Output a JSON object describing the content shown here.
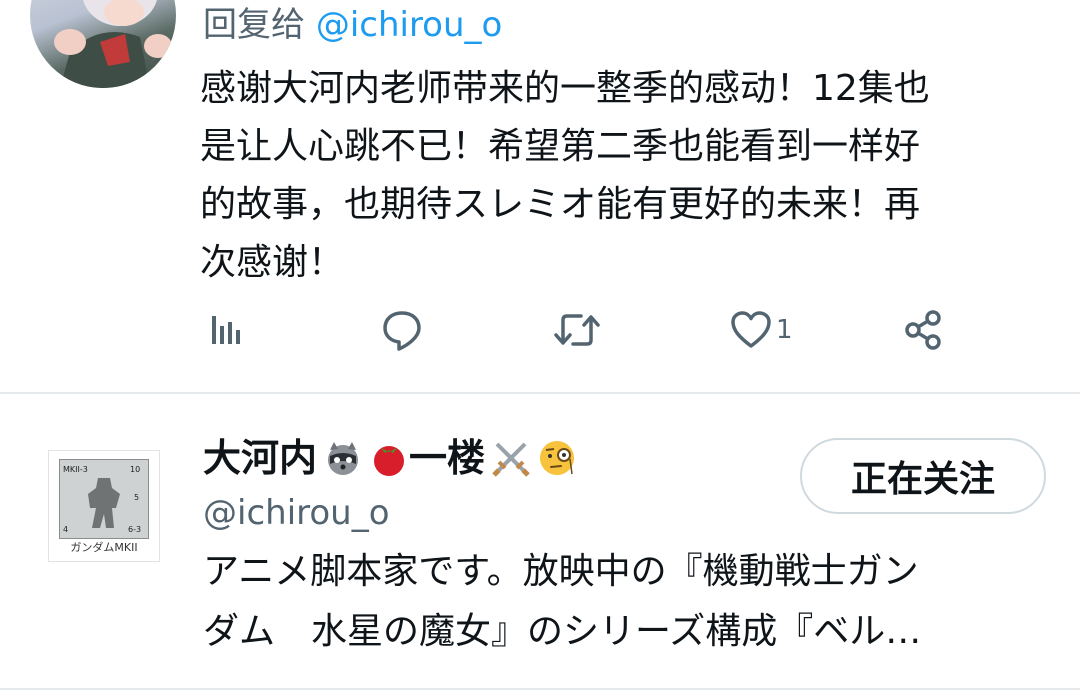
{
  "reply": {
    "prefix": "回复给",
    "handle": "@ichirou_o",
    "text": "感谢大河内老师带来的一整季的感动！12集也\n是让人心跳不已！希望第二季也能看到一样好\n的故事，也期待スレミオ能有更好的未来！再\n次感谢！",
    "actions": {
      "views_icon": "analytics-icon",
      "reply_icon": "reply-icon",
      "retweet_icon": "retweet-icon",
      "like_icon": "heart-icon",
      "like_count": "1",
      "share_icon": "share-icon"
    }
  },
  "profile": {
    "display_name": "大河内",
    "name_suffix": "一楼",
    "handle": "@ichirou_o",
    "avatar_caption": "ガンダムMKII",
    "follow_label": "正在关注",
    "bio_line1": "アニメ脚本家です。放映中の『機動戦士ガン",
    "bio_line2": "ダム　水星の魔女』のシリーズ構成『ベル…"
  },
  "colors": {
    "accent": "#1d9bf0",
    "text": "#0f1419",
    "muted": "#536471",
    "divider": "#e6e9ec"
  }
}
